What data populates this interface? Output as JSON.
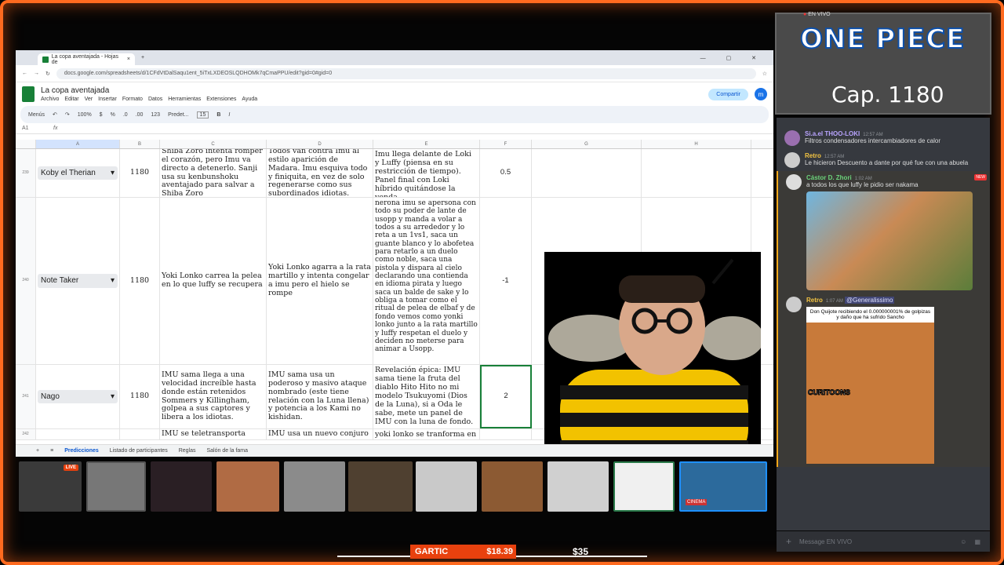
{
  "browser": {
    "tab_title": "La copa aventajada - Hojas de",
    "url": "docs.google.com/spreadsheets/d/1CFdVtDalSaqu1ent_5iTxLXDEOSLQDHOMk7qCmaPPU/edit?gid=0#gid=0"
  },
  "doc": {
    "title": "La copa aventajada",
    "menu": [
      "Archivo",
      "Editar",
      "Ver",
      "Insertar",
      "Formato",
      "Datos",
      "Herramientas",
      "Extensiones",
      "Ayuda"
    ],
    "share": "Compartir",
    "avatar": "m"
  },
  "toolbar": {
    "menus": "Menús",
    "zoom": "100%",
    "currency": "$",
    "percent": "%",
    "dec1": ".0",
    "dec2": ".00",
    "num": "123",
    "font": "Predet...",
    "size": "15",
    "bold": "B",
    "italic": "I"
  },
  "formula": {
    "cell": "A1",
    "fx": "fx"
  },
  "columns": [
    "A",
    "B",
    "C",
    "D",
    "E",
    "F",
    "G",
    "H"
  ],
  "rows": [
    {
      "num": "239",
      "player": "Koby el Therian",
      "chapter": "1180",
      "c": "Shiba Zoro intenta romper el corazón, pero Imu va directo a detenerlo. Sanji usa su kenbunshoku aventajado para salvar a Shiba Zoro",
      "d": "Todos van contra Imu al estilo aparición de Madara. Imu esquiva todo y finiquita, en vez de solo regenerarse como sus subordinados idiotas.",
      "e": "Imu llega delante de Loki y Luffy (piensa en su restricción de tiempo). Panel final con Loki híbrido quitándose la venda",
      "score": "0.5"
    },
    {
      "num": "240",
      "player": "Note Taker",
      "chapter": "1180",
      "c": "Yoki Lonko carrea la pelea en lo que luffy se recupera",
      "d": "Yoki Lonko agarra a la rata martillo y intenta congelar a imu pero el hielo se rompe",
      "e": "nerona imu se apersona con todo su poder de lante de usopp y manda a volar a todos a su arrededor y lo reta a un 1vs1, saca un guante blanco y lo abofetea para retarlo a un duelo como noble, saca una pistola y dispara al cielo declarando una contienda en idioma pirata y luego saca un balde de sake y lo obliga a tomar como el ritual de pelea de elbaf y de fondo vemos como yonki lonko junto a la rata martillo y luffy respetan el duelo y deciden no meterse para animar a Usopp.",
      "score": "-1"
    },
    {
      "num": "241",
      "player": "Nago",
      "chapter": "1180",
      "c": "IMU sama llega a una velocidad increíble hasta donde están retenidos Sommers y Killingham, golpea a sus captores y libera a los idiotas.",
      "d": "IMU sama usa un poderoso y masivo ataque nombrado (este tiene relación con la Luna llena) y potencia a los Kami no kishidan.",
      "e": "Revelación épica: IMU sama tiene la fruta del diablo Hito Hito no mi modelo Tsukuyomi (Dios de la Luna), si a Oda le sabe, mete un panel de IMU con la luna de fondo.",
      "score": "2"
    },
    {
      "num": "242",
      "player": "",
      "chapter": "",
      "c": "IMU se teletransporta",
      "d": "IMU usa un nuevo conjuro",
      "e": "yoki lonko se tranforma en",
      "score": ""
    }
  ],
  "sheets": [
    "Predicciones",
    "Listado de participantes",
    "Reglas",
    "Salón de la fama"
  ],
  "overlay": {
    "title": "ONE PIECE",
    "chapter": "Cap. 1180",
    "live": "EN VIVO",
    "live_badge": "LIVE",
    "cam_label": "CINEMA"
  },
  "chat": [
    {
      "user": "Si.a.el THOO-LOKI",
      "time": "12:57 AM",
      "text": "Filtros condensadores intercambiadores de calor",
      "color": "#b9a4ff"
    },
    {
      "user": "Retro",
      "time": "12:57 AM",
      "text": "Le hicieron Descuento a dante por qué fue con una abuela",
      "color": "#f5c542"
    },
    {
      "user": "Cástor D. Zhori",
      "time": "1:02 AM",
      "text": "a todos los que luffy le pidio ser nakama",
      "color": "#6bd27a",
      "badge": "NEW"
    },
    {
      "user": "Retro",
      "time": "1:07 AM",
      "text": "@Generalissimo",
      "color": "#f5c542",
      "meme": "Don Quijote recibiendo el 0.000000001% de golpizas y daño que ha sufrido Sancho",
      "meme_label": "CURITOONS"
    }
  ],
  "chat_input": "Message  EN VIVO",
  "bottom": {
    "label": "GARTIC",
    "amount": "$18.39",
    "other": "$35"
  }
}
